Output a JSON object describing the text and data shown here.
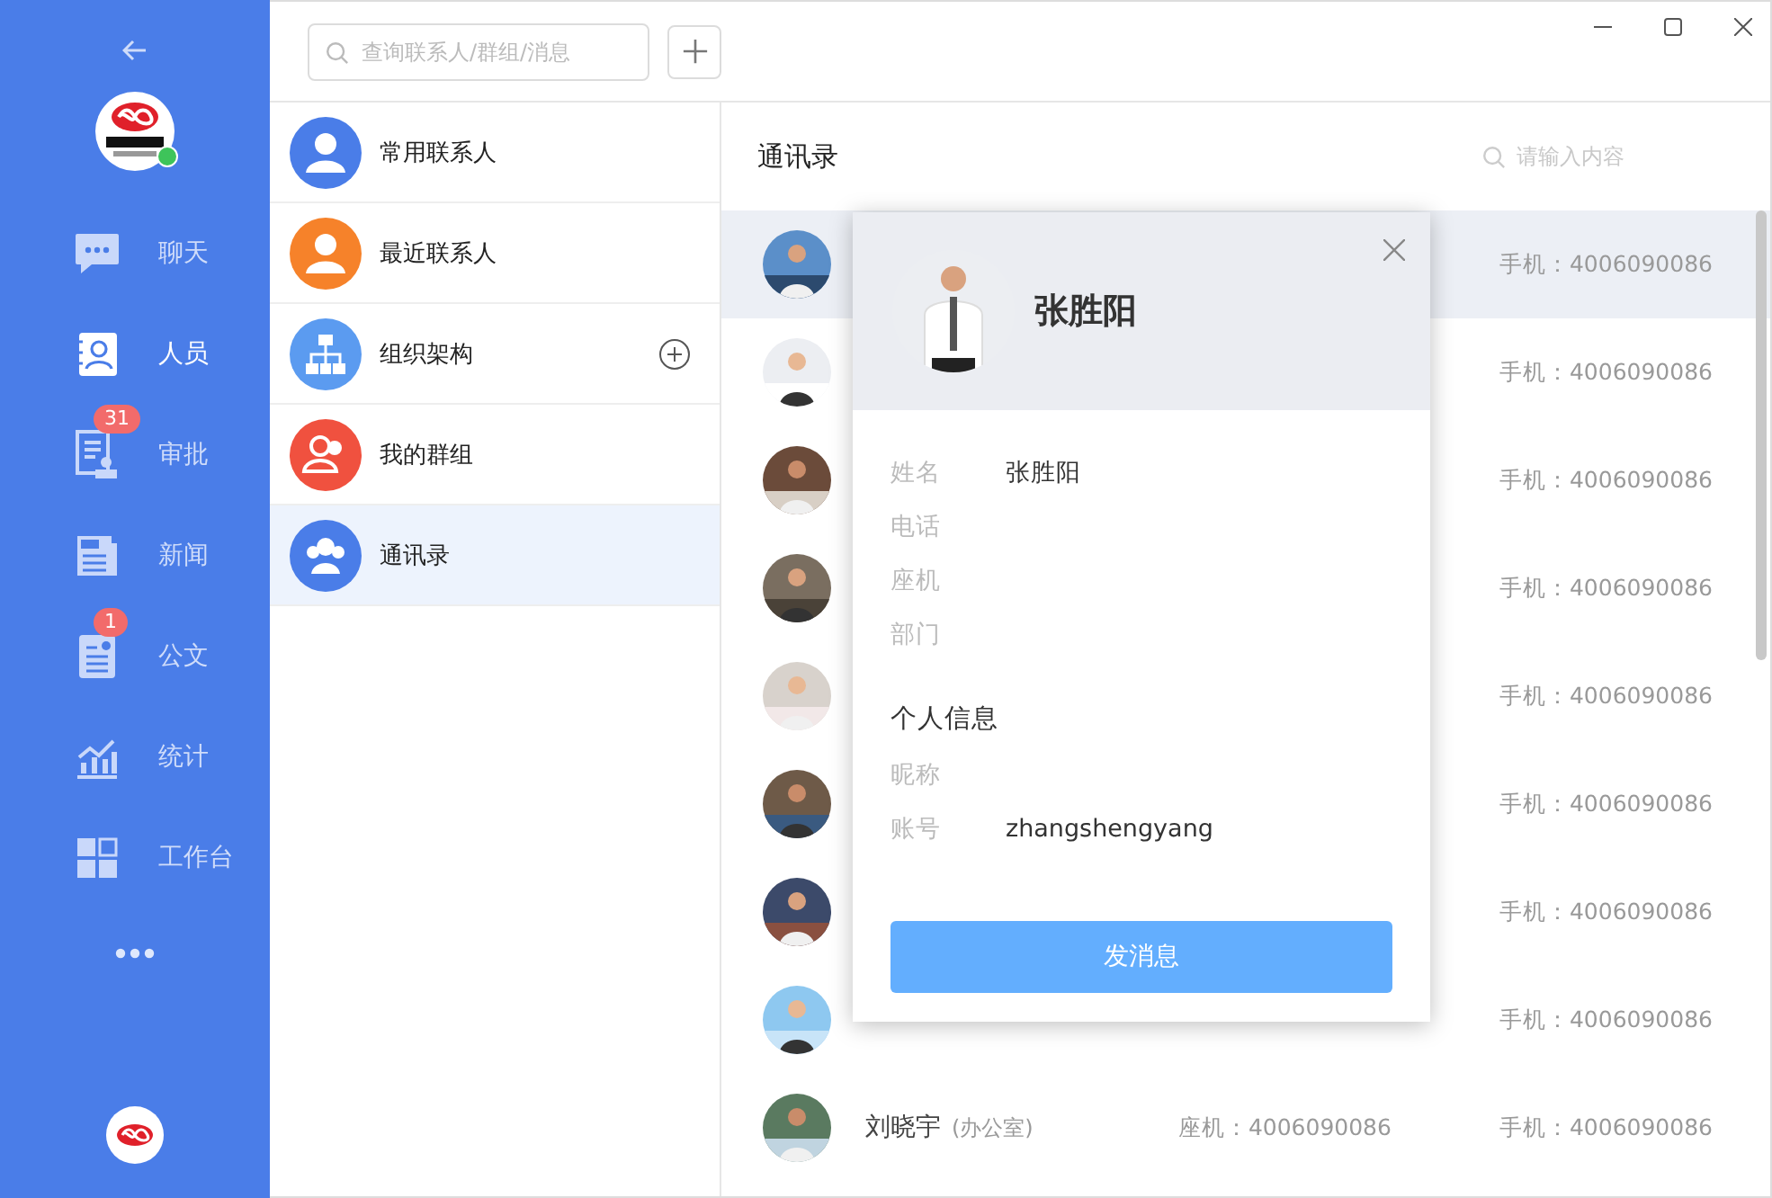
{
  "sidebar": {
    "items": [
      {
        "kind": "chat",
        "label": "聊天",
        "selected": false
      },
      {
        "kind": "people",
        "label": "人员",
        "selected": true
      },
      {
        "kind": "approval",
        "label": "审批",
        "selected": false,
        "badge": "31"
      },
      {
        "kind": "news",
        "label": "新闻",
        "selected": false
      },
      {
        "kind": "document",
        "label": "公文",
        "selected": false,
        "badge": "1"
      },
      {
        "kind": "stats",
        "label": "统计",
        "selected": false
      },
      {
        "kind": "workbench",
        "label": "工作台",
        "selected": false
      }
    ],
    "user_online": true
  },
  "search": {
    "placeholder": "查询联系人/群组/消息"
  },
  "groups": [
    {
      "kind": "person",
      "label": "常用联系人",
      "color": "#4a7de8",
      "selected": false
    },
    {
      "kind": "person",
      "label": "最近联系人",
      "color": "#f6822a",
      "selected": false
    },
    {
      "kind": "org",
      "label": "组织架构",
      "color": "#5b9bf0",
      "selected": false,
      "expandable": true
    },
    {
      "kind": "group",
      "label": "我的群组",
      "color": "#f0513f",
      "selected": false
    },
    {
      "kind": "contacts",
      "label": "通讯录",
      "color": "#4a7de8",
      "selected": true
    }
  ],
  "directory": {
    "title": "通讯录",
    "search_placeholder": "请输入内容",
    "rows": [
      {
        "selected": true,
        "mobile": "手机：4006090086"
      },
      {
        "selected": false,
        "mobile": "手机：4006090086"
      },
      {
        "selected": false,
        "mobile": "手机：4006090086"
      },
      {
        "selected": false,
        "mobile": "手机：4006090086"
      },
      {
        "selected": false,
        "mobile": "手机：4006090086"
      },
      {
        "selected": false,
        "mobile": "手机：4006090086"
      },
      {
        "selected": false,
        "mobile": "手机：4006090086"
      },
      {
        "selected": false,
        "mobile": "手机：4006090086"
      },
      {
        "selected": false,
        "name": "刘晓宇",
        "dept": "(办公室)",
        "landline": "座机：4006090086",
        "mobile": "手机：4006090086"
      }
    ]
  },
  "profile_card": {
    "name": "张胜阳",
    "fields": [
      {
        "label": "姓名",
        "value": "张胜阳"
      },
      {
        "label": "电话"
      },
      {
        "label": "座机"
      },
      {
        "label": "部门"
      }
    ],
    "section": "个人信息",
    "personal_fields": [
      {
        "label": "昵称"
      },
      {
        "label": "账号",
        "value": "zhangshengyang"
      }
    ],
    "button": "发消息"
  }
}
